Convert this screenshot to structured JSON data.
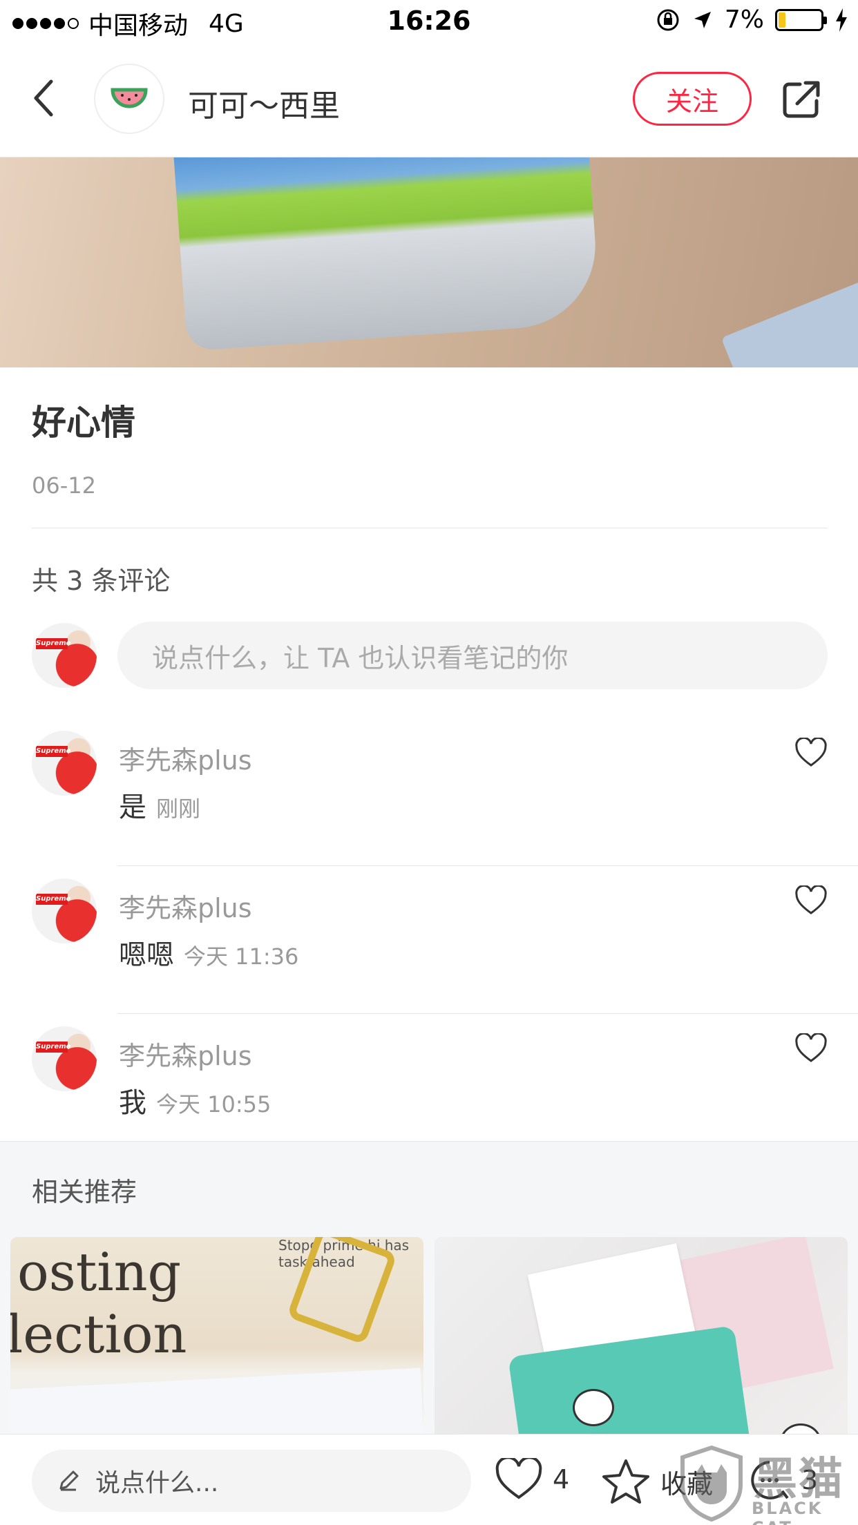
{
  "status_bar": {
    "carrier": "中国移动",
    "network": "4G",
    "time": "16:26",
    "battery": "7%"
  },
  "nav": {
    "title": "可可～西里",
    "follow_label": "关注"
  },
  "post": {
    "title": "好心情",
    "date": "06-12"
  },
  "comments_section": {
    "count_label": "共 3 条评论",
    "input_placeholder": "说点什么，让 TA 也认识看笔记的你",
    "items": [
      {
        "name": "李先森plus",
        "text": "是",
        "time": "刚刚"
      },
      {
        "name": "李先森plus",
        "text": "嗯嗯",
        "time": "今天 11:36"
      },
      {
        "name": "李先森plus",
        "text": "我",
        "time": "今天 10:55"
      }
    ]
  },
  "related": {
    "title": "相关推荐",
    "card1": {
      "line1": "osting",
      "line2": "lection",
      "small": "Stopg prime hi has task ahead"
    }
  },
  "bottom_bar": {
    "input_placeholder": "说点什么...",
    "likes": "4",
    "collect_label": "收藏",
    "comments": "3"
  },
  "watermark": {
    "cn": "黑猫",
    "en": "BLACK CAT"
  },
  "colors": {
    "accent": "#ff2442",
    "text": "#333333",
    "muted": "#999999"
  }
}
